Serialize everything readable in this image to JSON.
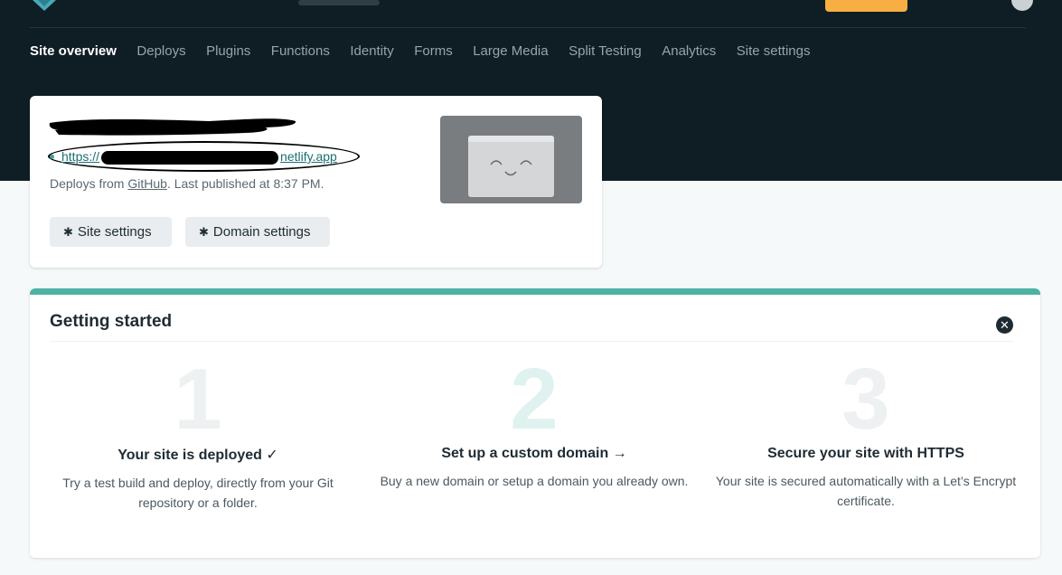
{
  "nav": {
    "items": [
      "Site overview",
      "Deploys",
      "Plugins",
      "Functions",
      "Identity",
      "Forms",
      "Large Media",
      "Split Testing",
      "Analytics",
      "Site settings"
    ],
    "active": "Site overview"
  },
  "site": {
    "url_prefix": "https://",
    "url_suffix": "netlify.app",
    "deploys_prefix": "Deploys from ",
    "deploys_source": "GitHub",
    "deploys_suffix": ". Last published at 8:37 PM.",
    "site_settings_label": "Site settings",
    "domain_settings_label": "Domain settings"
  },
  "getting_started": {
    "title": "Getting started",
    "steps": [
      {
        "number": "1",
        "title": "Your site is deployed ✓",
        "desc": "Try a test build and deploy, directly from your Git repository or a folder."
      },
      {
        "number": "2",
        "title": "Set up a custom domain →",
        "desc": "Buy a new domain or setup a domain you already own."
      },
      {
        "number": "3",
        "title": "Secure your site with HTTPS",
        "desc": "Your site is secured automatically with a Let’s Encrypt certificate."
      }
    ]
  },
  "colors": {
    "header_bg": "#0f1d24",
    "accent": "#4db2a4",
    "upgrade": "#f7ae43",
    "link": "#1c6f72"
  },
  "icons": {
    "gear": "gear-icon",
    "close": "close-icon",
    "status_dot": "status-dot-icon"
  }
}
